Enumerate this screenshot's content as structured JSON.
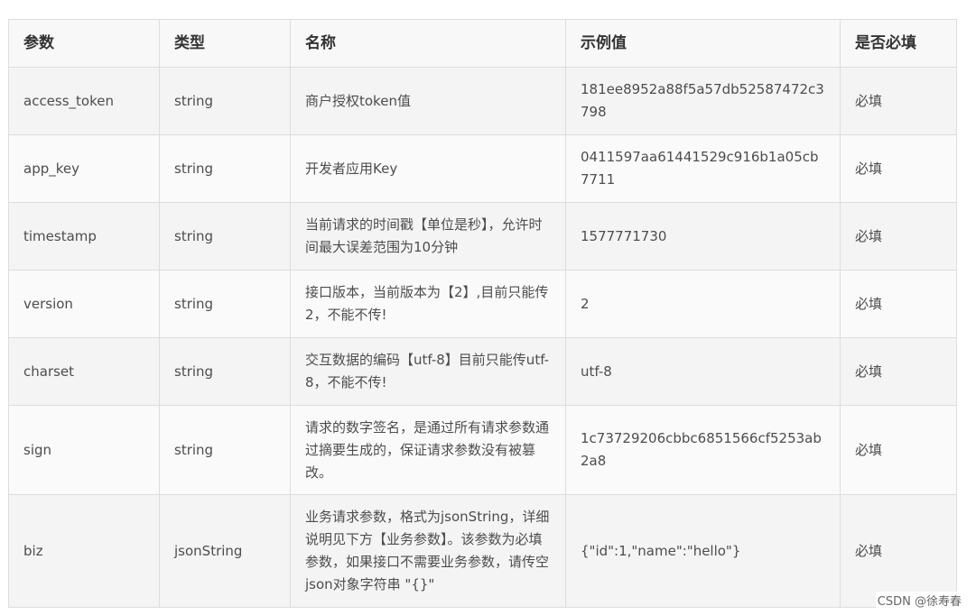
{
  "headers": [
    "参数",
    "类型",
    "名称",
    "示例值",
    "是否必填"
  ],
  "rows": [
    {
      "param": "access_token",
      "type": "string",
      "desc": "商户授权token值",
      "example": "181ee8952a88f5a57db52587472c3798",
      "required": "必填"
    },
    {
      "param": "app_key",
      "type": "string",
      "desc": "开发者应用Key",
      "example": "0411597aa61441529c916b1a05cb7711",
      "required": "必填"
    },
    {
      "param": "timestamp",
      "type": "string",
      "desc": "当前请求的时间戳【单位是秒】，允许时间最大误差范围为10分钟",
      "example": "1577771730",
      "required": "必填"
    },
    {
      "param": "version",
      "type": "string",
      "desc": "接口版本，当前版本为【2】,目前只能传2，不能不传!",
      "example": "2",
      "required": "必填"
    },
    {
      "param": "charset",
      "type": "string",
      "desc": "交互数据的编码【utf-8】目前只能传utf-8，不能不传!",
      "example": "utf-8",
      "required": "必填"
    },
    {
      "param": "sign",
      "type": "string",
      "desc": "请求的数字签名，是通过所有请求参数通过摘要生成的，保证请求参数没有被篡改。",
      "example": "1c73729206cbbc6851566cf5253ab2a8",
      "required": "必填"
    },
    {
      "param": "biz",
      "type": "jsonString",
      "desc": "业务请求参数，格式为jsonString，详细说明见下方【业务参数】。该参数为必填参数，如果接口不需要业务参数，请传空json对象字符串 \"{}\"",
      "example": "{\"id\":1,\"name\":\"hello\"}",
      "required": "必填"
    }
  ],
  "watermark": "CSDN @徐寿春"
}
